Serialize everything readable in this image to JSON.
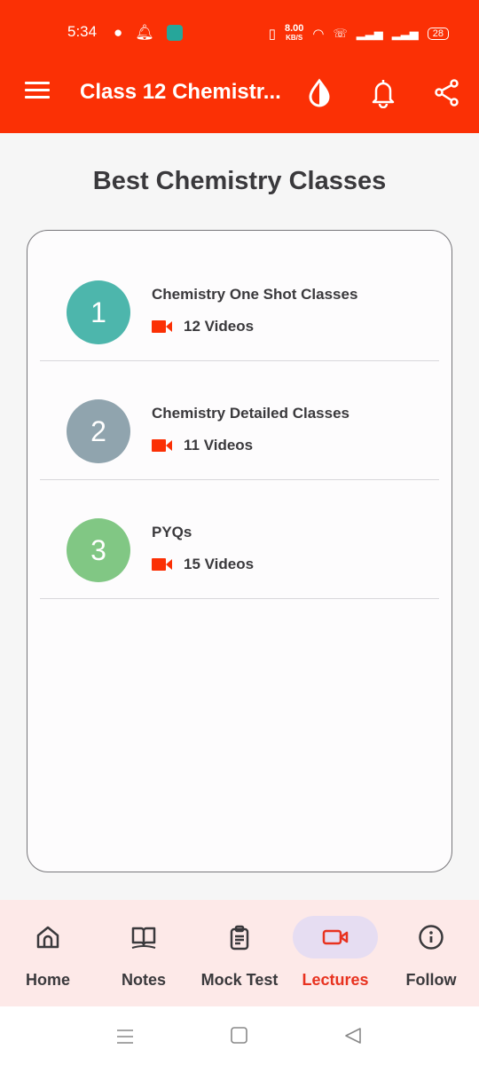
{
  "status_bar": {
    "time": "5:34",
    "speed_value": "8.00",
    "speed_unit": "KB/S",
    "battery": "28"
  },
  "app_bar": {
    "title": "Class 12 Chemistr...",
    "icons": [
      "menu-icon",
      "theme-drop-icon",
      "bell-icon",
      "share-icon"
    ]
  },
  "heading": "Best Chemistry Classes",
  "classes": [
    {
      "number": "1",
      "title": "Chemistry One Shot Classes",
      "videos": "12 Videos",
      "color": "#4db6ac"
    },
    {
      "number": "2",
      "title": "Chemistry Detailed Classes",
      "videos": "11 Videos",
      "color": "#90a4ae"
    },
    {
      "number": "3",
      "title": "PYQs",
      "videos": "15 Videos",
      "color": "#81c784"
    }
  ],
  "bottom_nav": {
    "active": "Lectures",
    "items": [
      {
        "label": "Home",
        "icon": "home-icon"
      },
      {
        "label": "Notes",
        "icon": "book-icon"
      },
      {
        "label": "Mock Test",
        "icon": "clipboard-icon"
      },
      {
        "label": "Lectures",
        "icon": "video-icon"
      },
      {
        "label": "Follow",
        "icon": "info-icon"
      }
    ]
  },
  "colors": {
    "primary": "#fb3005",
    "active_tab": "#e8321f",
    "nav_bg": "#fde9e8",
    "pill": "#e6ddf2"
  }
}
